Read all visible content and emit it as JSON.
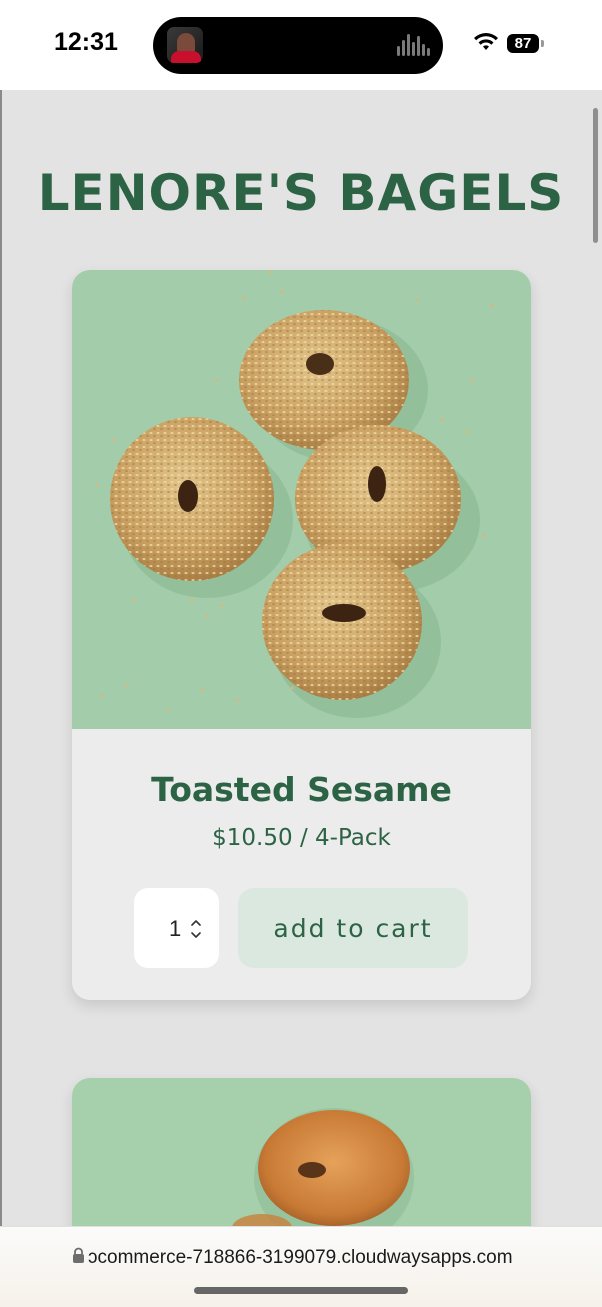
{
  "status_bar": {
    "time": "12:31",
    "battery": "87",
    "icons": [
      "dynamic-island-podcast-thumbnail",
      "audio-waveform-icon",
      "wifi-icon",
      "battery-icon"
    ]
  },
  "site": {
    "title": "LENORE'S BAGELS"
  },
  "products": [
    {
      "name": "Toasted Sesame",
      "price": "$10.50 / 4-Pack",
      "quantity": "1",
      "add_to_cart_label": "add to cart",
      "image": "four-sesame-bagels-on-green-background"
    },
    {
      "image": "plain-bagel-on-green-background"
    }
  ],
  "browser": {
    "url": "ɔcommerce-718866-3199079.cloudwaysapps.com"
  },
  "colors": {
    "brand_green": "#2c6344",
    "image_background": "#a3cdaa",
    "button_background": "#dbe8df",
    "page_background": "#e3e3e3"
  }
}
